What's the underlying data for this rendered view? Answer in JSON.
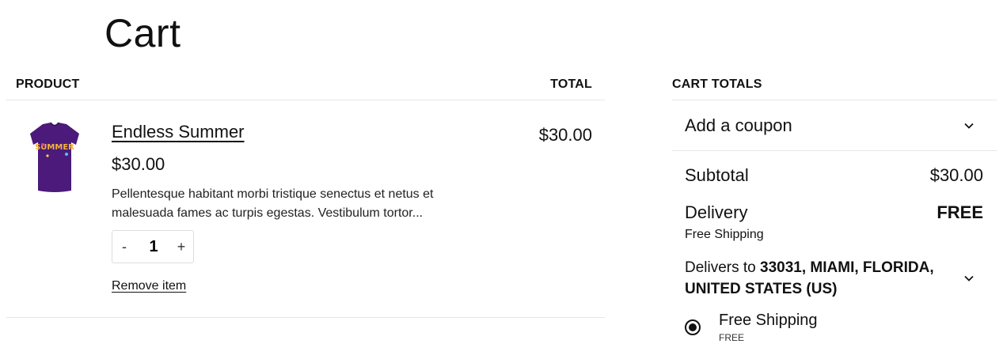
{
  "page": {
    "title": "Cart"
  },
  "table": {
    "col_product": "PRODUCT",
    "col_total": "TOTAL"
  },
  "items": [
    {
      "name": "Endless Summer",
      "price": "$30.00",
      "description": "Pellentesque habitant morbi tristique senectus et netus et malesuada fames ac turpis egestas. Vestibulum tortor...",
      "quantity": "1",
      "qty_minus": "-",
      "qty_plus": "+",
      "remove_label": "Remove item",
      "line_total": "$30.00",
      "thumbnail_text": "SUMMER",
      "thumbnail_color": "#4b1a7a"
    }
  ],
  "totals": {
    "title": "CART TOTALS",
    "coupon_label": "Add a coupon",
    "subtotal_label": "Subtotal",
    "subtotal_value": "$30.00",
    "delivery_label": "Delivery",
    "delivery_value": "FREE",
    "delivery_method": "Free Shipping",
    "delivers_to_prefix": "Delivers to",
    "delivers_to_address": "33031, MIAMI, FLORIDA, UNITED STATES (US)",
    "shipping_option_name": "Free Shipping",
    "shipping_option_price": "FREE",
    "shipping_option_selected": true
  },
  "icons": {
    "coupon_toggle": "chevron-down-icon",
    "address_toggle": "chevron-down-icon",
    "radio": "radio-selected-icon"
  }
}
